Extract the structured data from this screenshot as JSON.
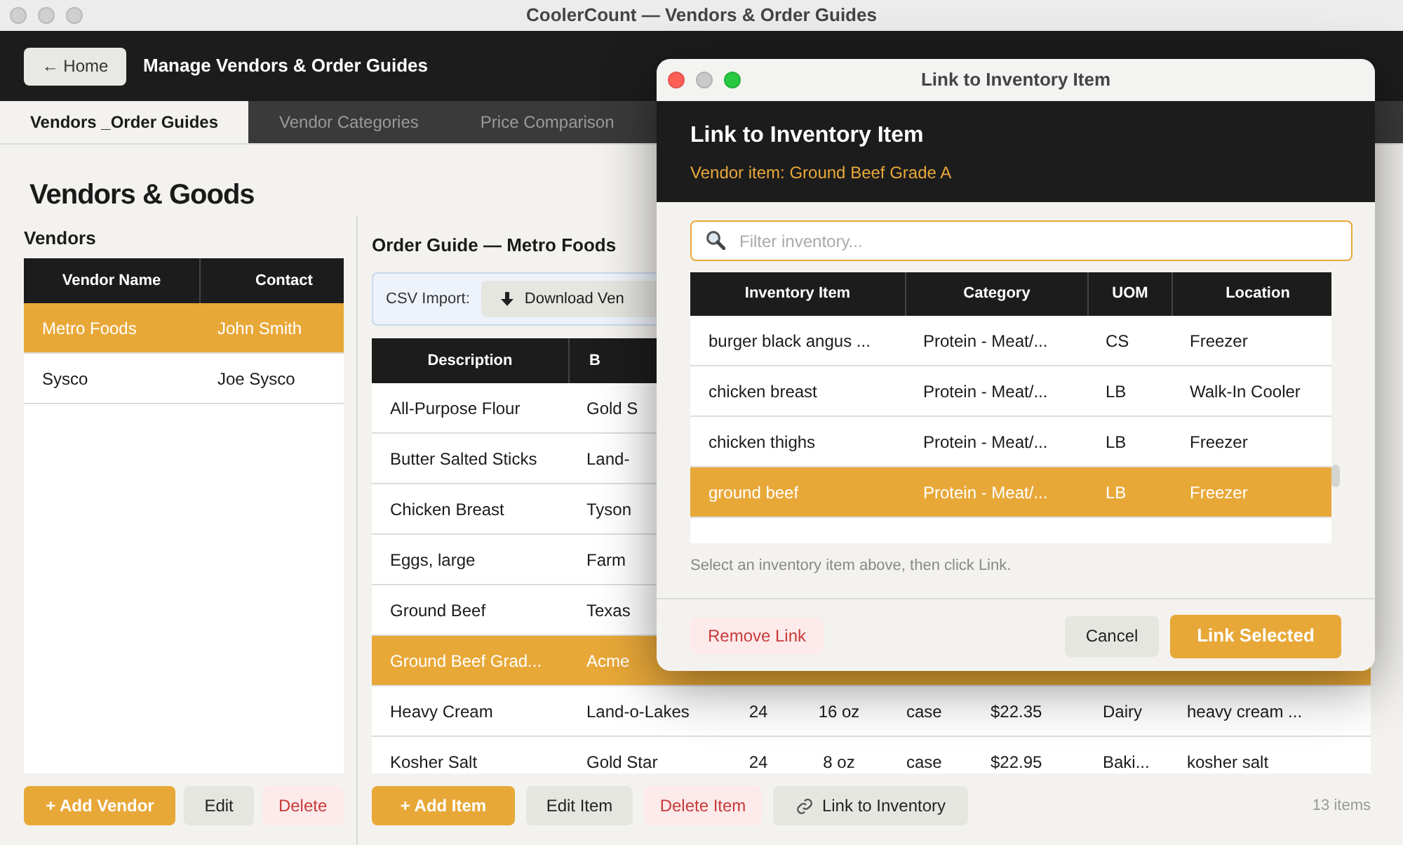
{
  "window": {
    "title": "CoolerCount — Vendors & Order Guides"
  },
  "header": {
    "back_button": "← Home",
    "title": "Manage Vendors & Order Guides"
  },
  "tabs": [
    {
      "label": "Vendors _Order Guides",
      "selected": true
    },
    {
      "label": "Vendor Categories",
      "selected": false
    },
    {
      "label": "Price Comparison",
      "selected": false
    }
  ],
  "page_title": "Vendors & Goods",
  "vendors": {
    "heading": "Vendors",
    "columns": [
      "Vendor Name",
      "Contact"
    ],
    "rows": [
      {
        "cells": [
          "Metro Foods",
          "John Smith"
        ],
        "selected": true
      },
      {
        "cells": [
          "Sysco",
          "Joe Sysco"
        ],
        "selected": false
      }
    ],
    "buttons": [
      {
        "label": "+ Add Vendor",
        "kind": "primary"
      },
      {
        "label": "Edit",
        "kind": "secondary"
      },
      {
        "label": "Delete",
        "kind": "danger"
      }
    ]
  },
  "order_guide": {
    "heading": "Order Guide — Metro Foods",
    "csv_import": {
      "label": "CSV Import:",
      "button": "Download Ven"
    },
    "columns": [
      "Description",
      "B"
    ],
    "rows": [
      {
        "cells": [
          "All-Purpose Flour",
          "Gold S"
        ],
        "selected": false
      },
      {
        "cells": [
          "Butter Salted Sticks",
          "Land-"
        ],
        "selected": false
      },
      {
        "cells": [
          "Chicken Breast",
          "Tyson"
        ],
        "selected": false
      },
      {
        "cells": [
          "Eggs, large",
          "Farm"
        ],
        "selected": false
      },
      {
        "cells": [
          "Ground Beef",
          "Texas"
        ],
        "selected": false
      },
      {
        "cells": [
          "Ground Beef Grad...",
          "Acme"
        ],
        "selected": true
      },
      {
        "cells": [
          "Heavy Cream",
          "Land-o-Lakes",
          "24",
          "16 oz",
          "case",
          "$22.35",
          "Dairy",
          "heavy cream ..."
        ],
        "selected": false
      },
      {
        "cells": [
          "Kosher Salt",
          "Gold Star",
          "24",
          "8 oz",
          "case",
          "$22.95",
          "Baki...",
          "kosher salt"
        ],
        "selected": false
      }
    ],
    "buttons": [
      {
        "label": "+ Add Item",
        "kind": "primary"
      },
      {
        "label": "Edit Item",
        "kind": "secondary"
      },
      {
        "label": "Delete Item",
        "kind": "danger"
      },
      {
        "label": "Link to Inventory",
        "kind": "link"
      }
    ],
    "count": "13 items"
  },
  "dialog": {
    "window_title": "Link to Inventory Item",
    "title": "Link to Inventory Item",
    "subtitle": "Vendor item: Ground Beef Grade A",
    "search": {
      "placeholder": "Filter inventory..."
    },
    "columns": [
      "Inventory Item",
      "Category",
      "UOM",
      "Location"
    ],
    "rows": [
      {
        "cells": [
          "burger black angus ...",
          "Protein - Meat/...",
          "CS",
          "Freezer"
        ],
        "selected": false
      },
      {
        "cells": [
          "chicken breast",
          "Protein - Meat/...",
          "LB",
          "Walk-In Cooler"
        ],
        "selected": false
      },
      {
        "cells": [
          "chicken thighs",
          "Protein - Meat/...",
          "LB",
          "Freezer"
        ],
        "selected": false
      },
      {
        "cells": [
          "ground beef",
          "Protein - Meat/...",
          "LB",
          "Freezer"
        ],
        "selected": true
      }
    ],
    "hint": "Select an inventory item above, then click Link.",
    "buttons": [
      {
        "label": "Remove Link",
        "kind": "danger"
      },
      {
        "label": "Cancel",
        "kind": "secondary"
      },
      {
        "label": "Link Selected",
        "kind": "primary"
      }
    ]
  }
}
